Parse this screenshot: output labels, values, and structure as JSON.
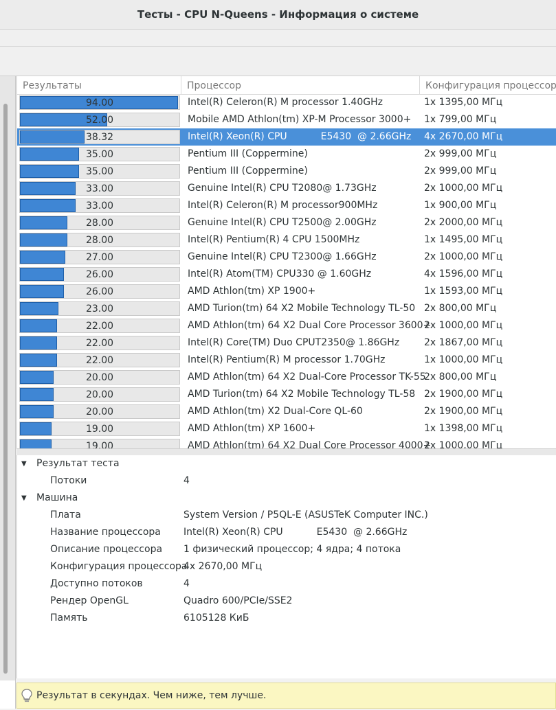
{
  "window": {
    "title": "Тесты - CPU N-Queens - Информация о системе"
  },
  "table": {
    "columns": [
      "Результаты",
      "Процессор",
      "Конфигурация процессора"
    ],
    "max_value": 94.0,
    "rows": [
      {
        "result": "94.00",
        "value": 94.0,
        "processor": "Intel(R) Celeron(R) M processor 1.40GHz",
        "config": "1x 1395,00 МГц"
      },
      {
        "result": "52.00",
        "value": 52.0,
        "processor": "Mobile AMD Athlon(tm) XP-M Processor 3000+",
        "config": "1x 799,00 МГц"
      },
      {
        "result": "38.32",
        "value": 38.32,
        "processor": "Intel(R) Xeon(R) CPU           E5430  @ 2.66GHz",
        "config": "4x 2670,00 МГц",
        "selected": true
      },
      {
        "result": "35.00",
        "value": 35.0,
        "processor": "Pentium III (Coppermine)",
        "config": "2x 999,00 МГц"
      },
      {
        "result": "35.00",
        "value": 35.0,
        "processor": "Pentium III (Coppermine)",
        "config": "2x 999,00 МГц"
      },
      {
        "result": "33.00",
        "value": 33.0,
        "processor": "Genuine Intel(R) CPU T2080@ 1.73GHz",
        "config": "2x 1000,00 МГц"
      },
      {
        "result": "33.00",
        "value": 33.0,
        "processor": "Intel(R) Celeron(R) M processor900MHz",
        "config": "1x 900,00 МГц"
      },
      {
        "result": "28.00",
        "value": 28.0,
        "processor": "Genuine Intel(R) CPU T2500@ 2.00GHz",
        "config": "2x 2000,00 МГц"
      },
      {
        "result": "28.00",
        "value": 28.0,
        "processor": "Intel(R) Pentium(R) 4 CPU 1500MHz",
        "config": "1x 1495,00 МГц"
      },
      {
        "result": "27.00",
        "value": 27.0,
        "processor": "Genuine Intel(R) CPU T2300@ 1.66GHz",
        "config": "2x 1000,00 МГц"
      },
      {
        "result": "26.00",
        "value": 26.0,
        "processor": "Intel(R) Atom(TM) CPU330 @ 1.60GHz",
        "config": "4x 1596,00 МГц"
      },
      {
        "result": "26.00",
        "value": 26.0,
        "processor": "AMD Athlon(tm) XP 1900+",
        "config": "1x 1593,00 МГц"
      },
      {
        "result": "23.00",
        "value": 23.0,
        "processor": "AMD Turion(tm) 64 X2 Mobile Technology TL-50",
        "config": "2x 800,00 МГц"
      },
      {
        "result": "22.00",
        "value": 22.0,
        "processor": "AMD Athlon(tm) 64 X2 Dual Core Processor 3600+",
        "config": "2x 1000,00 МГц"
      },
      {
        "result": "22.00",
        "value": 22.0,
        "processor": "Intel(R) Core(TM) Duo CPUT2350@ 1.86GHz",
        "config": "2x 1867,00 МГц"
      },
      {
        "result": "22.00",
        "value": 22.0,
        "processor": "Intel(R) Pentium(R) M processor 1.70GHz",
        "config": "1x 1000,00 МГц"
      },
      {
        "result": "20.00",
        "value": 20.0,
        "processor": "AMD Athlon(tm) 64 X2 Dual-Core Processor TK-55",
        "config": "2x 800,00 МГц"
      },
      {
        "result": "20.00",
        "value": 20.0,
        "processor": "AMD Turion(tm) 64 X2 Mobile Technology TL-58",
        "config": "2x 1900,00 МГц"
      },
      {
        "result": "20.00",
        "value": 20.0,
        "processor": "AMD Athlon(tm) X2 Dual-Core QL-60",
        "config": "2x 1900,00 МГц"
      },
      {
        "result": "19.00",
        "value": 19.0,
        "processor": "AMD Athlon(tm) XP 1600+",
        "config": "1x 1398,00 МГц"
      },
      {
        "result": "19.00",
        "value": 19.0,
        "processor": "AMD Athlon(tm) 64 X2 Dual Core Processor 4000+",
        "config": "2x 1000,00 МГц"
      }
    ]
  },
  "info": {
    "groups": [
      {
        "label": "Результат теста",
        "items": [
          {
            "key": "Потоки",
            "value": "4"
          }
        ]
      },
      {
        "label": "Машина",
        "items": [
          {
            "key": "Плата",
            "value": "System Version / P5QL-E (ASUSTeK Computer INC.)"
          },
          {
            "key": "Название процессора",
            "value": "Intel(R) Xeon(R) CPU           E5430  @ 2.66GHz"
          },
          {
            "key": "Описание процессора",
            "value": "1 физический процессор; 4 ядра; 4 потока"
          },
          {
            "key": "Конфигурация процессора",
            "value": "4x 2670,00 МГц"
          },
          {
            "key": "Доступно потоков",
            "value": "4"
          },
          {
            "key": "Рендер OpenGL",
            "value": "Quadro 600/PCIe/SSE2"
          },
          {
            "key": "Память",
            "value": "6105128 КиБ"
          }
        ]
      }
    ]
  },
  "status": {
    "message": "Результат в секундах. Чем ниже, тем лучше."
  },
  "colors": {
    "bar": "#3f86d4",
    "selection": "#4a90d9",
    "status_bg": "#fbf7c2"
  }
}
